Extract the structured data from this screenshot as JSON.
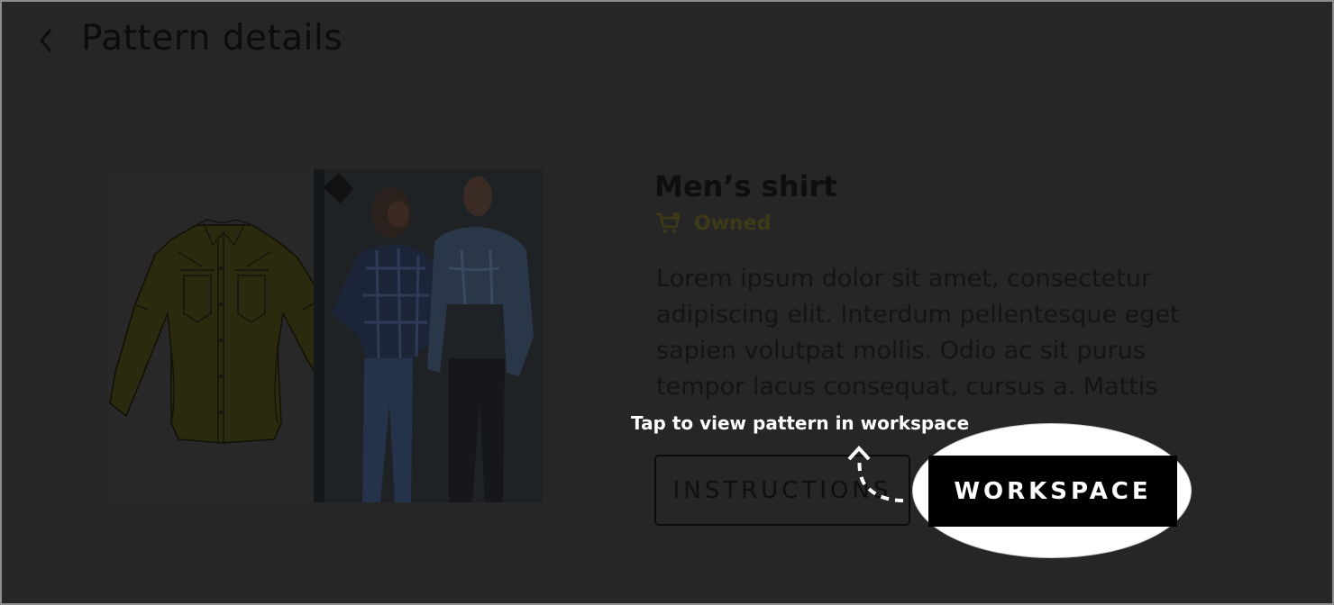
{
  "header": {
    "title": "Pattern details",
    "back_icon": "chevron-left-icon"
  },
  "media": {
    "sketch": "shirt-sketch-image",
    "photo": "models-photo-image"
  },
  "product": {
    "name": "Men’s shirt",
    "status_icon": "cart-icon",
    "status_label": "Owned",
    "description": "Lorem ipsum dolor sit amet, consectetur adipiscing elit. Interdum pellentesque eget sapien volutpat mollis. Odio ac sit purus tempor lacus consequat, cursus a. Mattis"
  },
  "actions": {
    "instructions_label": "INSTRUCTIONS",
    "workspace_label": "WORKSPACE"
  },
  "coachmark": {
    "hint": "Tap to view pattern in workspace",
    "arrow_icon": "dashed-curved-arrow-icon"
  },
  "colors": {
    "overlay": "#262626",
    "owned": "#3e3a18",
    "spotlight": "#ffffff",
    "workspace_button": "#000000"
  }
}
